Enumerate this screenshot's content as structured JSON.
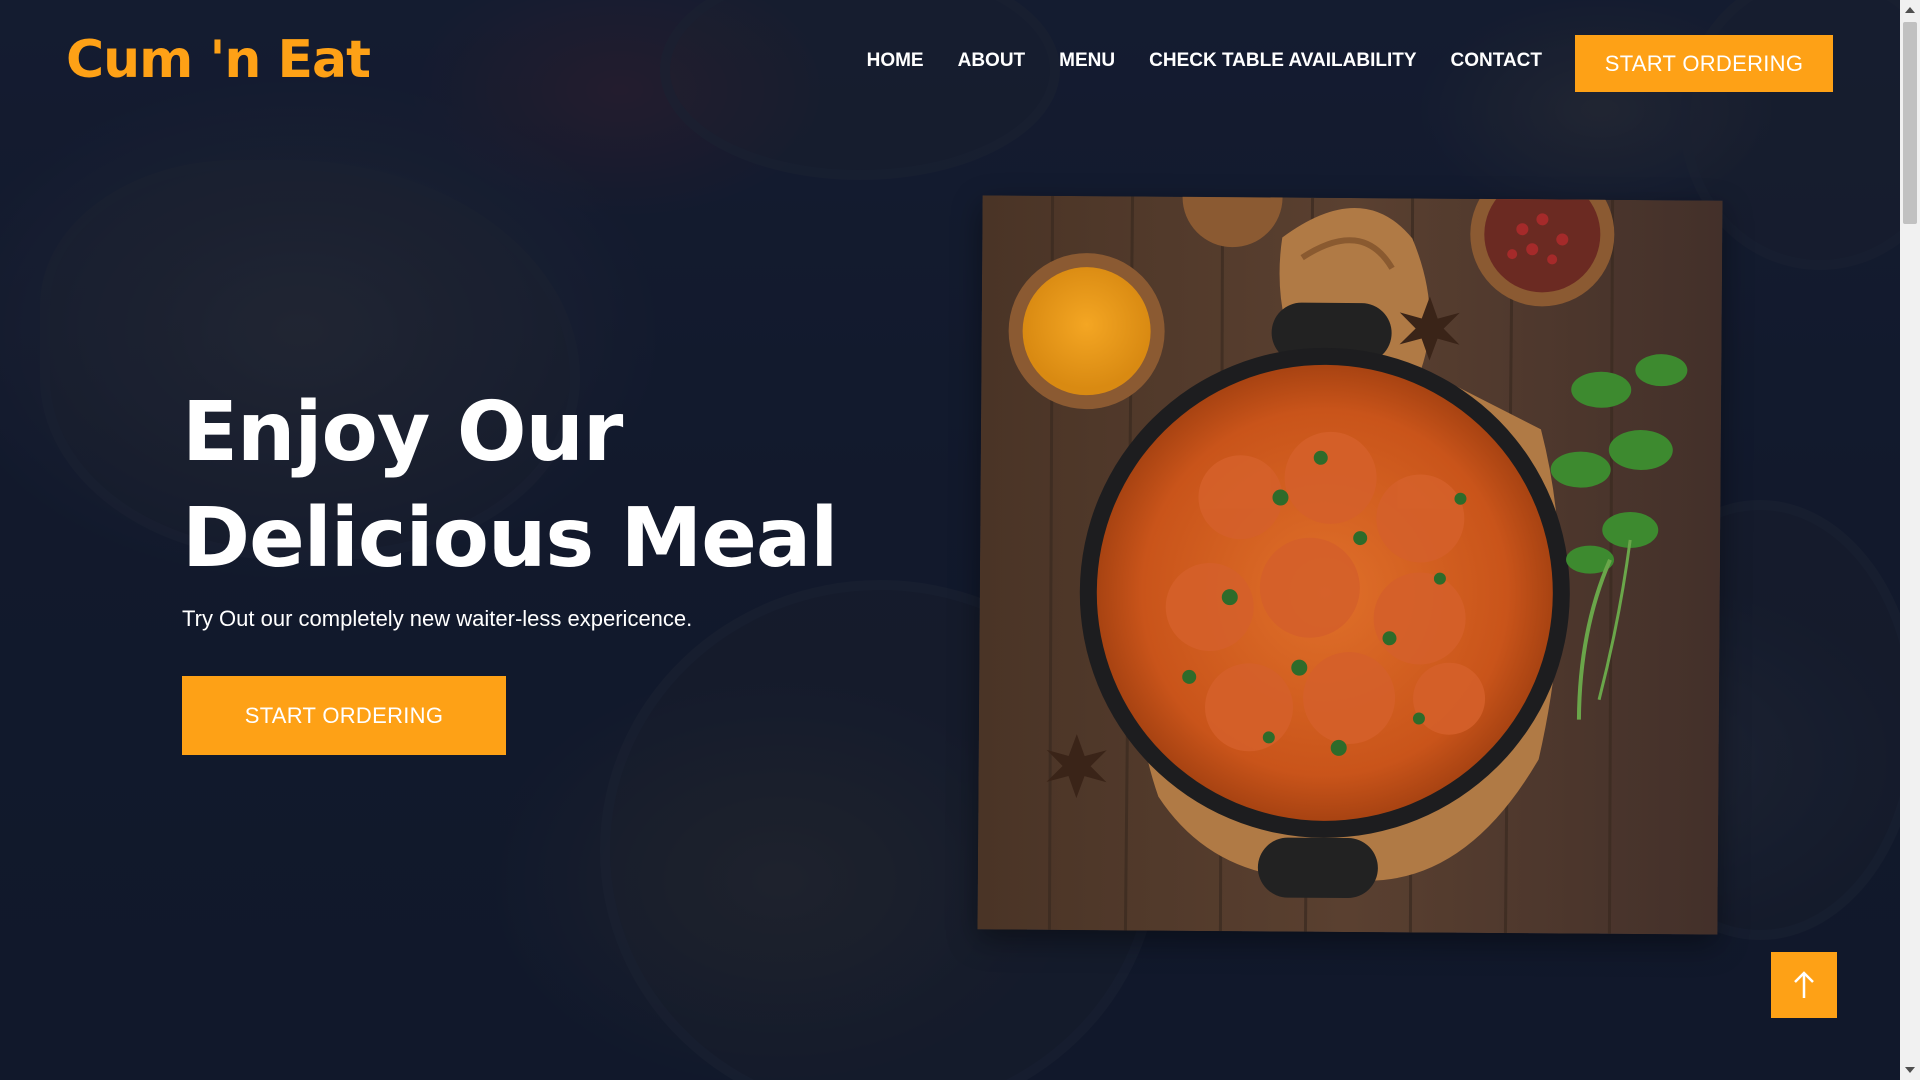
{
  "brand": {
    "name": "Cum 'n Eat",
    "accent_color": "#fea116"
  },
  "nav": {
    "items": [
      {
        "label": "HOME"
      },
      {
        "label": "ABOUT"
      },
      {
        "label": "MENU"
      },
      {
        "label": "CHECK TABLE AVAILABILITY"
      },
      {
        "label": "CONTACT"
      }
    ],
    "cta_label": "START ORDERING"
  },
  "hero": {
    "title_line1": "Enjoy Our",
    "title_line2": "Delicious Meal",
    "subtitle": "Try Out our completely new waiter-less expericence.",
    "cta_label": "START ORDERING",
    "image_icon": "butter-chicken-photo"
  },
  "back_to_top": {
    "icon": "arrow-up-icon"
  }
}
